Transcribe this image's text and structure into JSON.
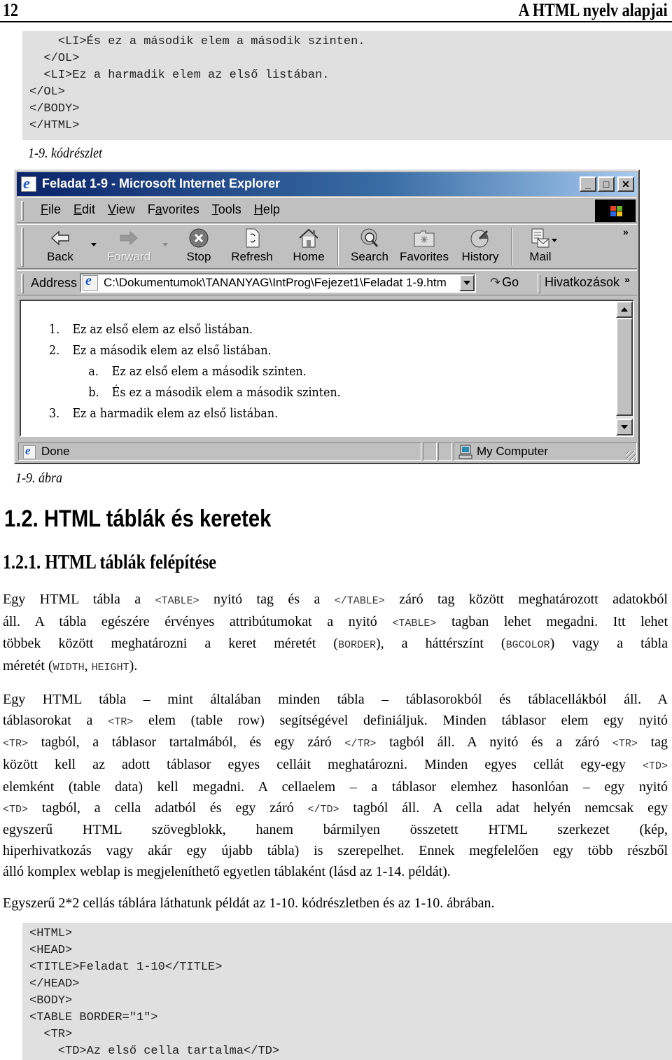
{
  "page_header": {
    "page_number": "12",
    "chapter_title": "A HTML nyelv alapjai"
  },
  "code_block_1": {
    "lines": [
      "    <LI>És ez a második elem a második szinten.",
      "  </OL>",
      "  <LI>Ez a harmadik elem az első listában.",
      "</OL>",
      "</BODY>",
      "</HTML>"
    ],
    "caption": "1-9. kódrészlet"
  },
  "browser": {
    "title": "Feladat 1-9 - Microsoft Internet Explorer",
    "window_buttons": [
      "minimize",
      "maximize",
      "close"
    ],
    "menu": [
      {
        "label": "File",
        "accel": "F"
      },
      {
        "label": "Edit",
        "accel": "E"
      },
      {
        "label": "View",
        "accel": "V"
      },
      {
        "label": "Favorites",
        "accel": "a"
      },
      {
        "label": "Tools",
        "accel": "T"
      },
      {
        "label": "Help",
        "accel": "H"
      }
    ],
    "toolbar": {
      "back": "Back",
      "forward": "Forward",
      "stop": "Stop",
      "refresh": "Refresh",
      "home": "Home",
      "search": "Search",
      "favorites": "Favorites",
      "history": "History",
      "mail": "Mail",
      "more": "»"
    },
    "address": {
      "label": "Address",
      "value": "C:\\Dokumentumok\\TANANYAG\\IntProg\\Fejezet1\\Feladat 1-9.htm",
      "go": "Go",
      "links": "Hivatkozások",
      "links_more": "»"
    },
    "content": {
      "items": [
        {
          "marker": "1.",
          "text": "Ez az első elem az első listában.",
          "level": 1
        },
        {
          "marker": "2.",
          "text": "Ez a második elem az első listában.",
          "level": 1
        },
        {
          "marker": "a.",
          "text": "Ez az első elem a második szinten.",
          "level": 2
        },
        {
          "marker": "b.",
          "text": "És ez a második elem a második szinten.",
          "level": 2
        },
        {
          "marker": "3.",
          "text": "Ez a harmadik elem az első listában.",
          "level": 1
        }
      ]
    },
    "status": {
      "text": "Done",
      "zone": "My Computer"
    }
  },
  "figure_caption": "1-9. ábra",
  "section": {
    "heading": "1.2. HTML táblák és keretek",
    "subheading": "1.2.1. HTML táblák felépítése"
  },
  "paragraphs": {
    "p1": {
      "l1": [
        "Egy HTML tábla a ",
        "<TABLE>",
        " nyitó tag és a ",
        "</TABLE>",
        " záró tag között meghatározott adatokból"
      ],
      "l2": [
        "áll. A tábla egészére érvényes attribútumokat a nyitó ",
        "<TABLE>",
        " tagban lehet megadni. Itt lehet"
      ],
      "l3": [
        "többek között meghatározni a keret méretét (",
        "BORDER",
        "), a háttérszínt (",
        "BGCOLOR",
        ") vagy a tábla"
      ],
      "l4": [
        "méretét (",
        "WIDTH",
        ", ",
        "HEIGHT",
        ")."
      ]
    },
    "p2": {
      "l1": [
        "Egy HTML tábla – mint általában minden tábla – táblasorokból és táblacellákból áll. A"
      ],
      "l2": [
        "táblasorokat a ",
        "<TR>",
        " elem (table row) segítségével definiáljuk. Minden táblasor elem egy nyitó"
      ],
      "l3": [
        "",
        "<TR>",
        " tagból, a táblasor tartalmából, és egy záró ",
        "</TR>",
        " tagból áll. A nyitó és a záró ",
        "<TR>",
        " tag"
      ],
      "l4": [
        "között kell az adott táblasor egyes celláit meghatározni. Minden egyes cellát egy-egy ",
        "<TD>"
      ],
      "l5": [
        "elemként (table data) kell megadni. A cellaelem – a táblasor elemhez hasonlóan – egy nyitó"
      ],
      "l6": [
        "",
        "<TD>",
        " tagból, a cella adatból és egy záró ",
        "</TD>",
        " tagból áll. A cella adat helyén nemcsak egy"
      ],
      "l7": [
        "egyszerű HTML szövegblokk, hanem bármilyen összetett HTML szerkezet (kép,"
      ],
      "l8": [
        "hiperhivatkozás vagy akár egy újabb tábla) is szerepelhet. Ennek megfelelően egy több részből"
      ],
      "l9": [
        "álló komplex weblap is megjeleníthető egyetlen táblaként (lásd az 1-14. példát)."
      ]
    },
    "p3": "Egyszerű 2*2 cellás táblára láthatunk példát az 1-10. kódrészletben és az 1-10. ábrában."
  },
  "code_block_2": {
    "lines": [
      "<HTML>",
      "<HEAD>",
      "<TITLE>Feladat 1-10</TITLE>",
      "</HEAD>",
      "<BODY>",
      "<TABLE BORDER=\"1\">",
      "  <TR>",
      "    <TD>Az első cella tartalma</TD>"
    ]
  }
}
